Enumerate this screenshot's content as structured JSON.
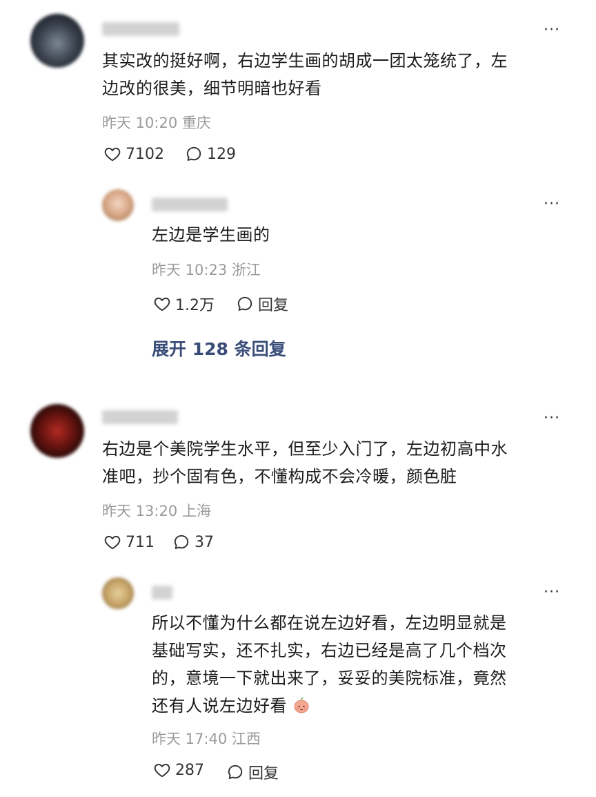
{
  "comments": [
    {
      "username": "肖容儿萝",
      "text": "其实改的挺好啊，右边学生画的胡成一团太笼统了，左边改的很美，细节明暗也好看",
      "text_line1": "其实改的挺好啊，右边学生画的胡成一团太笼统了，左",
      "text_line2": "边改的很美，细节明暗也好看",
      "time": "昨天 10:20",
      "location": "重庆",
      "likes": "7102",
      "replies": "129",
      "reply": {
        "username": "啦啦花花",
        "text": "左边是学生画的",
        "time": "昨天 10:23",
        "location": "浙江",
        "likes": "1.2万",
        "reply_label": "回复"
      },
      "expand_label": "展开 128 条回复"
    },
    {
      "username": "蹦迪的鸟",
      "text_line1": "右边是个美院学生水平，但至少入门了，左边初高中水",
      "text_line2": "准吧，抄个固有色，不懂构成不会冷暖，颜色脏",
      "time": "昨天 13:20",
      "location": "上海",
      "likes": "711",
      "replies": "37",
      "reply": {
        "username": "然",
        "text_line1": "所以不懂为什么都在说左边好看，左边明显就是",
        "text_line2": "基础写实，还不扎实，右边已经是高了几个档次",
        "text_line3": "的，意境一下就出来了，妥妥的美院标准，竟然",
        "text_line4": "还有人说左边好看",
        "emoji": "peach-emoji",
        "time": "昨天 17:40",
        "location": "江西",
        "likes": "287",
        "reply_label": "回复"
      }
    }
  ],
  "more_label": "···",
  "colors": {
    "link": "#3a4d78",
    "meta": "#9a9a9a",
    "text": "#1c1c1c"
  }
}
